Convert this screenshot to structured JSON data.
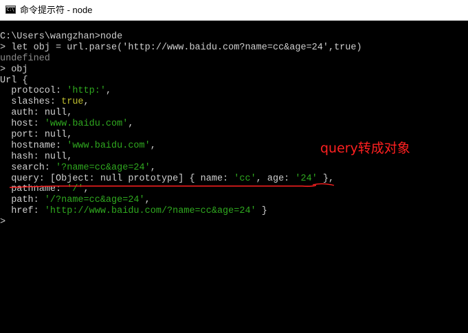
{
  "window": {
    "title": "命令提示符 - node",
    "icon": "console-icon"
  },
  "console": {
    "lines": [
      [
        {
          "t": "C:\\Users\\wangzhan>node",
          "c": "w"
        }
      ],
      [
        {
          "t": "> let obj = url.parse('http://www.baidu.com?name=cc&age=24',true)",
          "c": "w"
        }
      ],
      [
        {
          "t": "undefined",
          "c": "gray"
        }
      ],
      [
        {
          "t": "> obj",
          "c": "w"
        }
      ],
      [
        {
          "t": "Url {",
          "c": "w"
        }
      ],
      [
        {
          "t": "  protocol: ",
          "c": "w"
        },
        {
          "t": "'http:'",
          "c": "green"
        },
        {
          "t": ",",
          "c": "w"
        }
      ],
      [
        {
          "t": "  slashes: ",
          "c": "w"
        },
        {
          "t": "true",
          "c": "yellow"
        },
        {
          "t": ",",
          "c": "w"
        }
      ],
      [
        {
          "t": "  auth: ",
          "c": "w"
        },
        {
          "t": "null",
          "c": "w"
        },
        {
          "t": ",",
          "c": "w"
        }
      ],
      [
        {
          "t": "  host: ",
          "c": "w"
        },
        {
          "t": "'www.baidu.com'",
          "c": "green"
        },
        {
          "t": ",",
          "c": "w"
        }
      ],
      [
        {
          "t": "  port: ",
          "c": "w"
        },
        {
          "t": "null",
          "c": "w"
        },
        {
          "t": ",",
          "c": "w"
        }
      ],
      [
        {
          "t": "  hostname: ",
          "c": "w"
        },
        {
          "t": "'www.baidu.com'",
          "c": "green"
        },
        {
          "t": ",",
          "c": "w"
        }
      ],
      [
        {
          "t": "  hash: ",
          "c": "w"
        },
        {
          "t": "null",
          "c": "w"
        },
        {
          "t": ",",
          "c": "w"
        }
      ],
      [
        {
          "t": "  search: ",
          "c": "w"
        },
        {
          "t": "'?name=cc&age=24'",
          "c": "green"
        },
        {
          "t": ",",
          "c": "w"
        }
      ],
      [
        {
          "t": "  query: [Object: null prototype] { name: ",
          "c": "w"
        },
        {
          "t": "'cc'",
          "c": "green"
        },
        {
          "t": ", age: ",
          "c": "w"
        },
        {
          "t": "'24'",
          "c": "green"
        },
        {
          "t": " },",
          "c": "w"
        }
      ],
      [
        {
          "t": "  pathname: ",
          "c": "w"
        },
        {
          "t": "'/'",
          "c": "green"
        },
        {
          "t": ",",
          "c": "w"
        }
      ],
      [
        {
          "t": "  path: ",
          "c": "w"
        },
        {
          "t": "'/?name=cc&age=24'",
          "c": "green"
        },
        {
          "t": ",",
          "c": "w"
        }
      ],
      [
        {
          "t": "  href: ",
          "c": "w"
        },
        {
          "t": "'http://www.baidu.com/?name=cc&age=24'",
          "c": "green"
        },
        {
          "t": " }",
          "c": "w"
        }
      ],
      [
        {
          "t": ">",
          "c": "w"
        }
      ]
    ]
  },
  "annotation": {
    "text": "query转成对象",
    "color": "#ff2020"
  },
  "colors": {
    "background": "#000000",
    "text": "#cfcfcf",
    "string": "#2fa81f",
    "boolean": "#bfbf2f",
    "undefined": "#8a8a8a"
  }
}
